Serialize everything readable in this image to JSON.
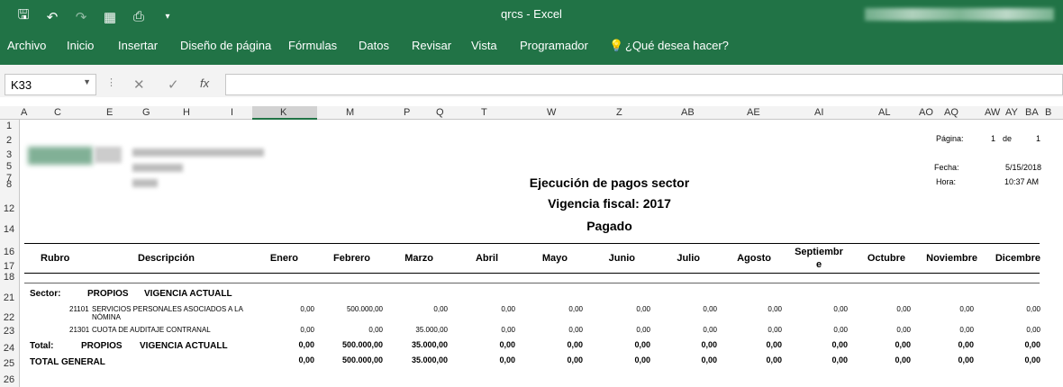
{
  "window": {
    "doc_title": "qrcs  -  Excel"
  },
  "ribbon": {
    "tabs": [
      "Archivo",
      "Inicio",
      "Insertar",
      "Diseño de página",
      "Fórmulas",
      "Datos",
      "Revisar",
      "Vista",
      "Programador"
    ],
    "tell_me": "¿Qué desea hacer?"
  },
  "formula_bar": {
    "cell_ref": "K33",
    "fx": "fx",
    "cancel": "✕",
    "enter": "✓",
    "value": ""
  },
  "columns": [
    "A",
    "C",
    "E",
    "G",
    "H",
    "I",
    "K",
    "M",
    "P",
    "Q",
    "T",
    "W",
    "Z",
    "AB",
    "AE",
    "AI",
    "AL",
    "AO",
    "AQ",
    "AW",
    "AY",
    "BA",
    "B"
  ],
  "rows": [
    "1",
    "2",
    "3",
    "5",
    "7",
    "8",
    "12",
    "14",
    "16",
    "17",
    "18",
    "21",
    "22",
    "23",
    "24",
    "25",
    "26"
  ],
  "report": {
    "pagina_label": "Página:",
    "pagina": "1",
    "de_label": "de",
    "de_total": "1",
    "fecha_label": "Fecha:",
    "fecha": "5/15/2018",
    "hora_label": "Hora:",
    "hora": "10:37 AM",
    "title1": "Ejecución de pagos sector",
    "title2": "Vigencia fiscal: 2017",
    "title3": "Pagado",
    "headers": [
      "Rubro",
      "Descripción",
      "Enero",
      "Febrero",
      "Marzo",
      "Abril",
      "Mayo",
      "Junio",
      "Julio",
      "Agosto",
      "Septiembr e",
      "Octubre",
      "Noviembre",
      "Dicembre"
    ],
    "sector_label": "Sector:",
    "sector_name": "PROPIOS",
    "sector_vig": "VIGENCIA ACTUALL",
    "items": [
      {
        "code": "21101",
        "desc": "SERVICIOS PERSONALES ASOCIADOS A LA NÓMINA",
        "values": [
          "0,00",
          "500.000,00",
          "0,00",
          "0,00",
          "0,00",
          "0,00",
          "0,00",
          "0,00",
          "0,00",
          "0,00",
          "0,00",
          "0,00"
        ]
      },
      {
        "code": "21301",
        "desc": "CUOTA DE AUDITAJE CONTRANAL",
        "values": [
          "0,00",
          "0,00",
          "35.000,00",
          "0,00",
          "0,00",
          "0,00",
          "0,00",
          "0,00",
          "0,00",
          "0,00",
          "0,00",
          "0,00"
        ]
      }
    ],
    "total": {
      "label": "Total:",
      "name": "PROPIOS",
      "vig": "VIGENCIA ACTUALL",
      "values": [
        "0,00",
        "500.000,00",
        "35.000,00",
        "0,00",
        "0,00",
        "0,00",
        "0,00",
        "0,00",
        "0,00",
        "0,00",
        "0,00",
        "0,00"
      ]
    },
    "total_general": {
      "label": "TOTAL GENERAL",
      "values": [
        "0,00",
        "500.000,00",
        "35.000,00",
        "0,00",
        "0,00",
        "0,00",
        "0,00",
        "0,00",
        "0,00",
        "0,00",
        "0,00",
        "0,00"
      ]
    }
  }
}
